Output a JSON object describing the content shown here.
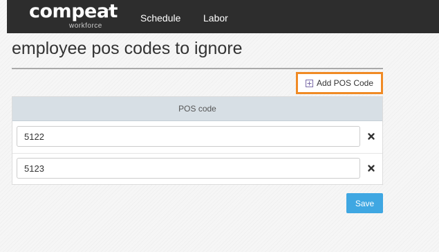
{
  "nav": {
    "logo_main": "compeat",
    "logo_sub": "workforce",
    "logo_tm": "™",
    "items": [
      {
        "label": "Schedule"
      },
      {
        "label": "Labor"
      }
    ]
  },
  "page": {
    "title": "employee pos codes to ignore"
  },
  "toolbar": {
    "add_label": "Add POS Code",
    "add_icon": "plus-square-icon"
  },
  "table": {
    "header": "POS code",
    "rows": [
      {
        "code": "5122",
        "remove_icon": "close-icon"
      },
      {
        "code": "5123",
        "remove_icon": "close-icon"
      }
    ]
  },
  "actions": {
    "save_label": "Save"
  },
  "colors": {
    "nav_bg": "#2d2d2d",
    "highlight": "#f08a24",
    "save_bg": "#3fa7e2",
    "header_bg": "#d7dfe5"
  }
}
